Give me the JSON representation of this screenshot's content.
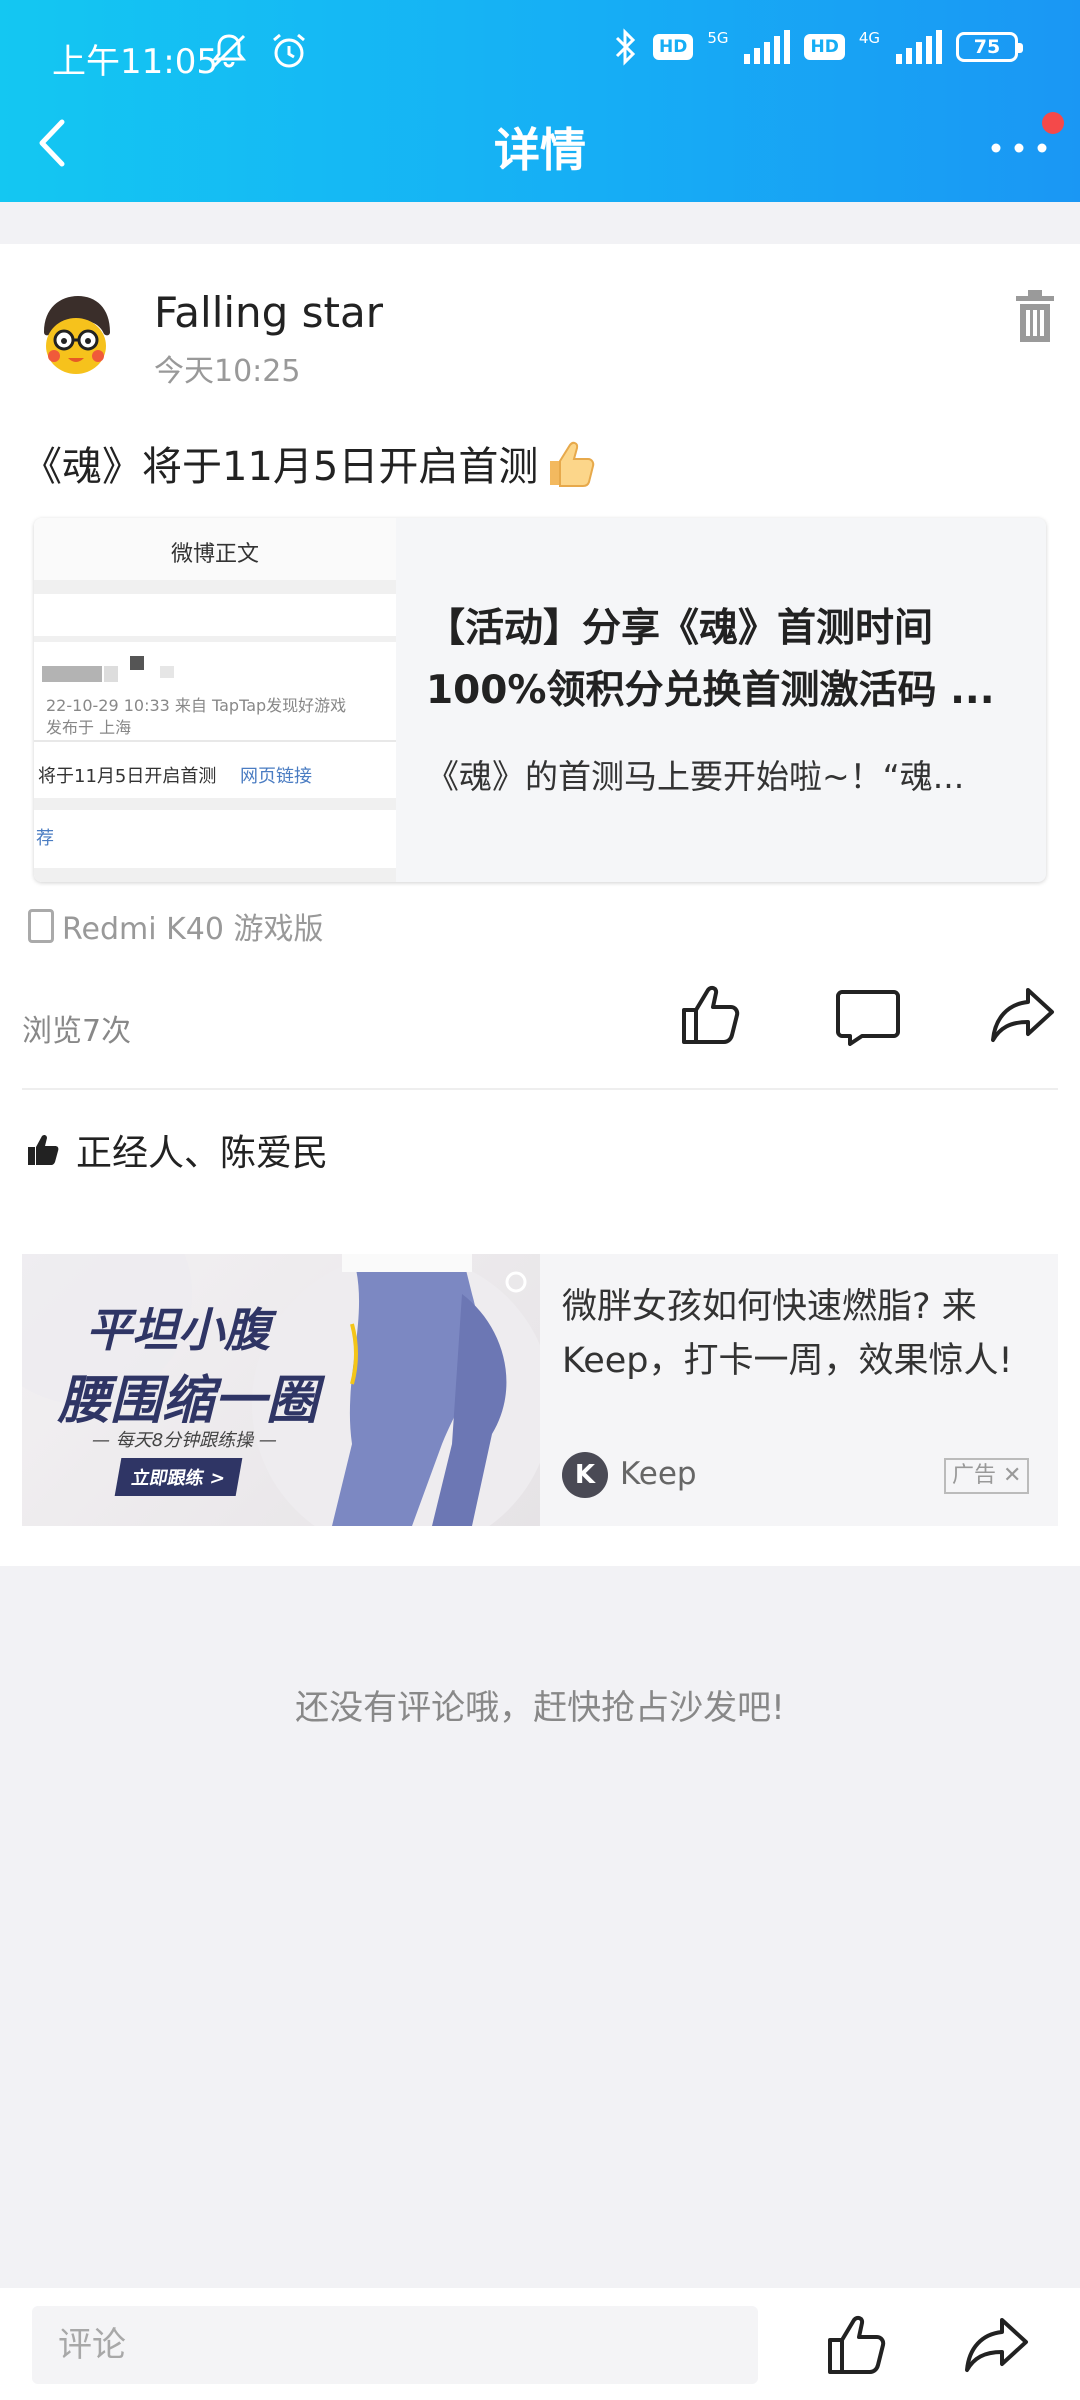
{
  "status_bar": {
    "time": "上午11:05",
    "battery": "75",
    "network_1": "5G",
    "network_2": "4G",
    "hd": "HD"
  },
  "nav": {
    "title": "详情",
    "back_icon": "chevron-left-icon",
    "more_icon": "more-dots-icon"
  },
  "post": {
    "username": "Falling star",
    "time": "今天10:25",
    "text": "《魂》将于11月5日开启首测",
    "link_card": {
      "thumb_title": "微博正文",
      "thumb_date": "22-10-29 10:33  来自 TapTap发现好游戏",
      "thumb_location": "发布于 上海",
      "thumb_text": "将于11月5日开启首测",
      "thumb_link": "网页链接",
      "thumb_tail": "荐",
      "title": "【活动】分享《魂》首测时间100%领积分兑换首测激活码 ...",
      "desc": "《魂》的首测马上要开始啦~！“魂..."
    },
    "device": "Redmi K40 游戏版",
    "views": "浏览7次",
    "likes": "正经人、陈爱民"
  },
  "ad": {
    "line1": "平坦小腹",
    "line2": "腰围缩一圈",
    "line3": "— 每天8分钟跟练操 —",
    "cta": "立即跟练 >",
    "text": "微胖女孩如何快速燃脂? 来Keep，打卡一周，效果惊人!",
    "brand": "Keep",
    "logo_letter": "K",
    "tag": "广告 ✕"
  },
  "comments": {
    "empty_text": "还没有评论哦，赶快抢占沙发吧!"
  },
  "bottom_bar": {
    "comment_placeholder": "评论"
  },
  "colors": {
    "header_start": "#14c7f2",
    "header_end": "#1a97f4",
    "notification_dot": "#f4494a"
  }
}
